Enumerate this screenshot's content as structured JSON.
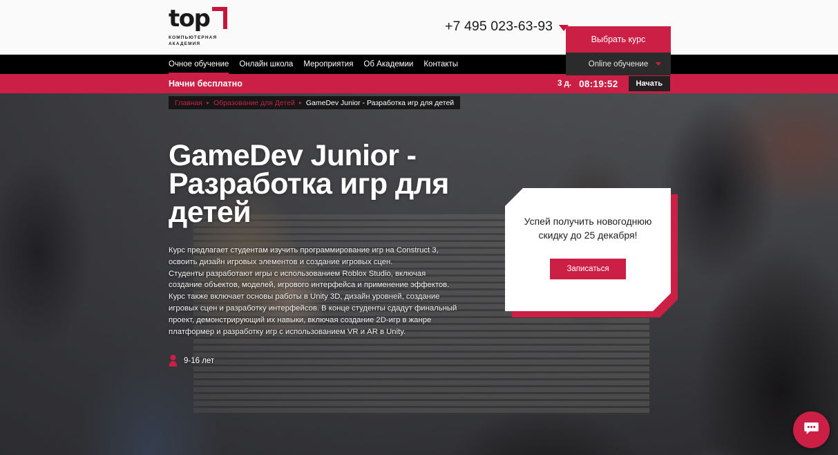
{
  "header": {
    "logo": {
      "word": "top",
      "sub_line1": "КОМПЬЮТЕРНАЯ",
      "sub_line2": "АКАДЕМИЯ",
      "bracket_icon": "logo-bracket-icon"
    },
    "phone": "+7 495 023-63-93",
    "phone_caret_icon": "caret-down-icon",
    "choose_course_label": "Выбрать курс",
    "online_learning_label": "Online обучение",
    "online_learning_caret_icon": "caret-down-small-icon"
  },
  "nav": {
    "items": [
      {
        "label": "Очное обучение",
        "active": true
      },
      {
        "label": "Онлайн школа",
        "active": false
      },
      {
        "label": "Мероприятия",
        "active": false
      },
      {
        "label": "Об Академии",
        "active": false
      },
      {
        "label": "Контакты",
        "active": false
      }
    ]
  },
  "promo_bar": {
    "label": "Начни бесплатно",
    "timer_days": "3 д.",
    "timer_clock": "08:19:52",
    "start_button_label": "Начать"
  },
  "breadcrumb": {
    "items": [
      {
        "label": "Главная",
        "current": false
      },
      {
        "label": "Образование для Детей",
        "current": false
      },
      {
        "label": "GameDev Junior - Разработка игр для детей",
        "current": true
      }
    ],
    "separator": "▸"
  },
  "hero": {
    "title": "GameDev Junior - Разработка игр для детей",
    "description_p1": "Курс предлагает студентам изучить программирование игр на Construct 3, освоить дизайн игровых элементов и создание игровых сцен.",
    "description_p2": "Студенты разработают игры с использованием Roblox Studio, включая создание объектов, моделей, игрового интерфейса и применение эффектов. Курс также включает основы работы в Unity 3D, дизайн уровней, создание игровых сцен и разработку интерфейсов. В конце студенты сдадут финальный проект, демонстрирующий их навыки, включая создание 2D-игр в жанре платформер и разработку игр с использованием VR и AR в Unity.",
    "age_icon": "person-icon",
    "age_label": "9-16 лет"
  },
  "promo_card": {
    "text": "Успей получить новогоднюю скидку до 25 декабря!",
    "signup_label": "Записаться"
  },
  "chat": {
    "icon": "chat-bubble-icon"
  },
  "colors": {
    "crimson": "#cc1f45",
    "logo_red": "#c8143c",
    "nav_black": "#000000",
    "header_bg": "#fafafa",
    "dark_button": "#2b2b2b",
    "start_button": "#241f20"
  }
}
